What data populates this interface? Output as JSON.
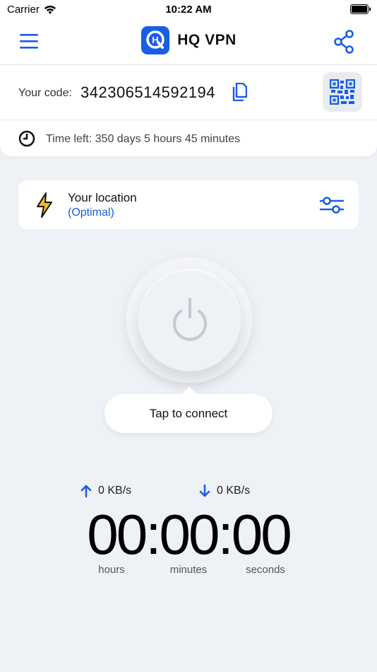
{
  "status_bar": {
    "carrier": "Carrier",
    "time": "10:22 AM"
  },
  "header": {
    "app_name": "HQ VPN",
    "logo_letter": "H",
    "menu_icon": "hamburger-menu-icon",
    "share_icon": "share-icon"
  },
  "code": {
    "label": "Your code:",
    "value": "342306514592194",
    "copy_icon": "copy-icon",
    "qr_icon": "qr-code-icon"
  },
  "time_left": {
    "text": "Time left: 350 days 5 hours 45 minutes",
    "icon": "clock-icon"
  },
  "location": {
    "title": "Your location",
    "subtitle": "(Optimal)",
    "icon": "lightning-bolt-icon",
    "settings_icon": "sliders-icon"
  },
  "connect": {
    "tooltip": "Tap to connect",
    "icon": "power-icon"
  },
  "speed": {
    "upload": "0 KB/s",
    "download": "0 KB/s"
  },
  "timer": {
    "value": "00:00:00",
    "labels": {
      "hours": "hours",
      "minutes": "minutes",
      "seconds": "seconds"
    }
  },
  "colors": {
    "accent": "#1a5ee6",
    "bolt": "#f5b81c",
    "background": "#eef1f5"
  }
}
